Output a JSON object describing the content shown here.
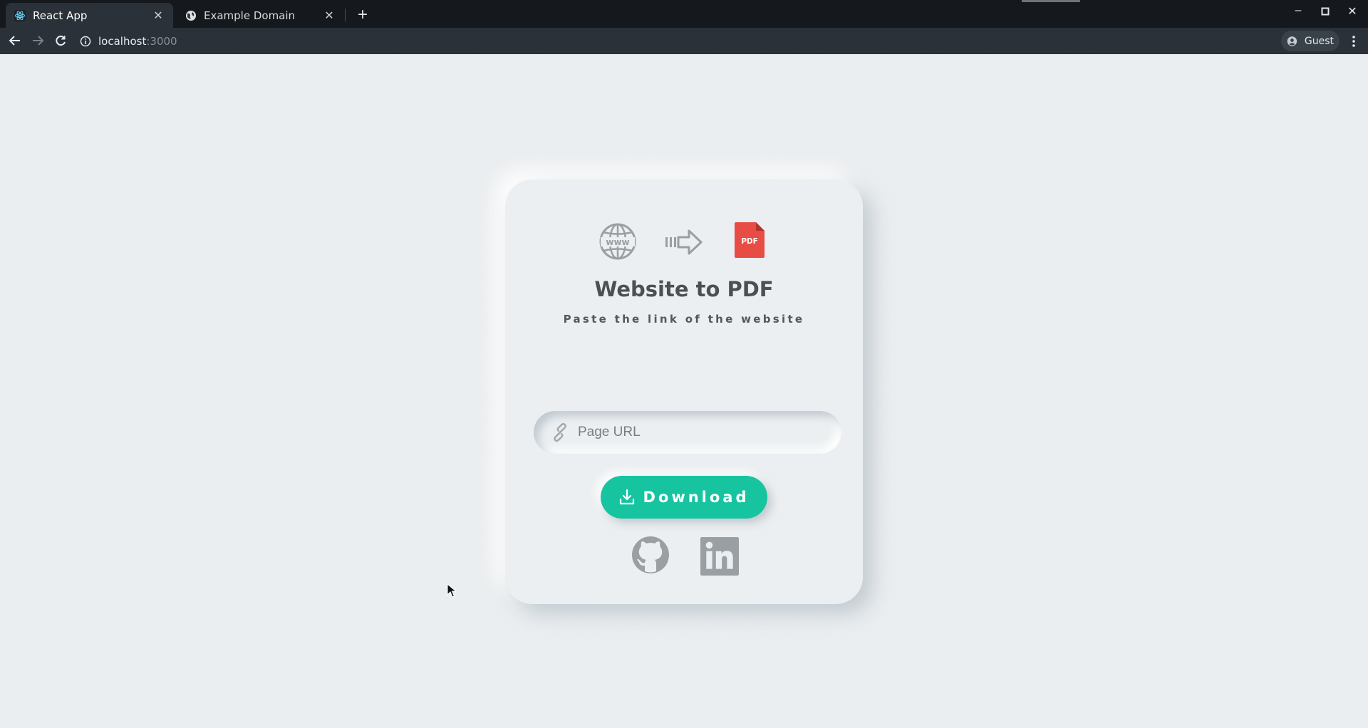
{
  "browser": {
    "tabs": [
      {
        "title": "React App",
        "favicon": "react-logo-icon",
        "active": true
      },
      {
        "title": "Example Domain",
        "favicon": "globe-icon",
        "active": false
      }
    ],
    "new_tab_icon": "plus-icon",
    "address": {
      "host": "localhost",
      "port": ":3000",
      "info_icon": "info-icon"
    },
    "profile": {
      "label": "Guest",
      "icon": "account-circle-icon"
    },
    "menu_icon": "kebab-menu-icon",
    "window_controls": [
      "minimize-icon",
      "maximize-icon",
      "close-icon"
    ]
  },
  "app": {
    "icons": [
      "www-globe-icon",
      "arrow-right-icon",
      "pdf-file-icon"
    ],
    "pdf_label": "PDF",
    "title": "Website to PDF",
    "subtitle": "Paste the link of the website",
    "url_input": {
      "placeholder": "Page URL",
      "value": "",
      "icon": "link-icon"
    },
    "download_button": {
      "label": "Download",
      "icon": "download-icon"
    },
    "social": [
      "github-icon",
      "linkedin-icon"
    ],
    "colors": {
      "accent": "#16c4a0",
      "background": "#eceff1",
      "pdf_red": "#e74c45",
      "icon_gray": "#9a9fa3"
    }
  }
}
